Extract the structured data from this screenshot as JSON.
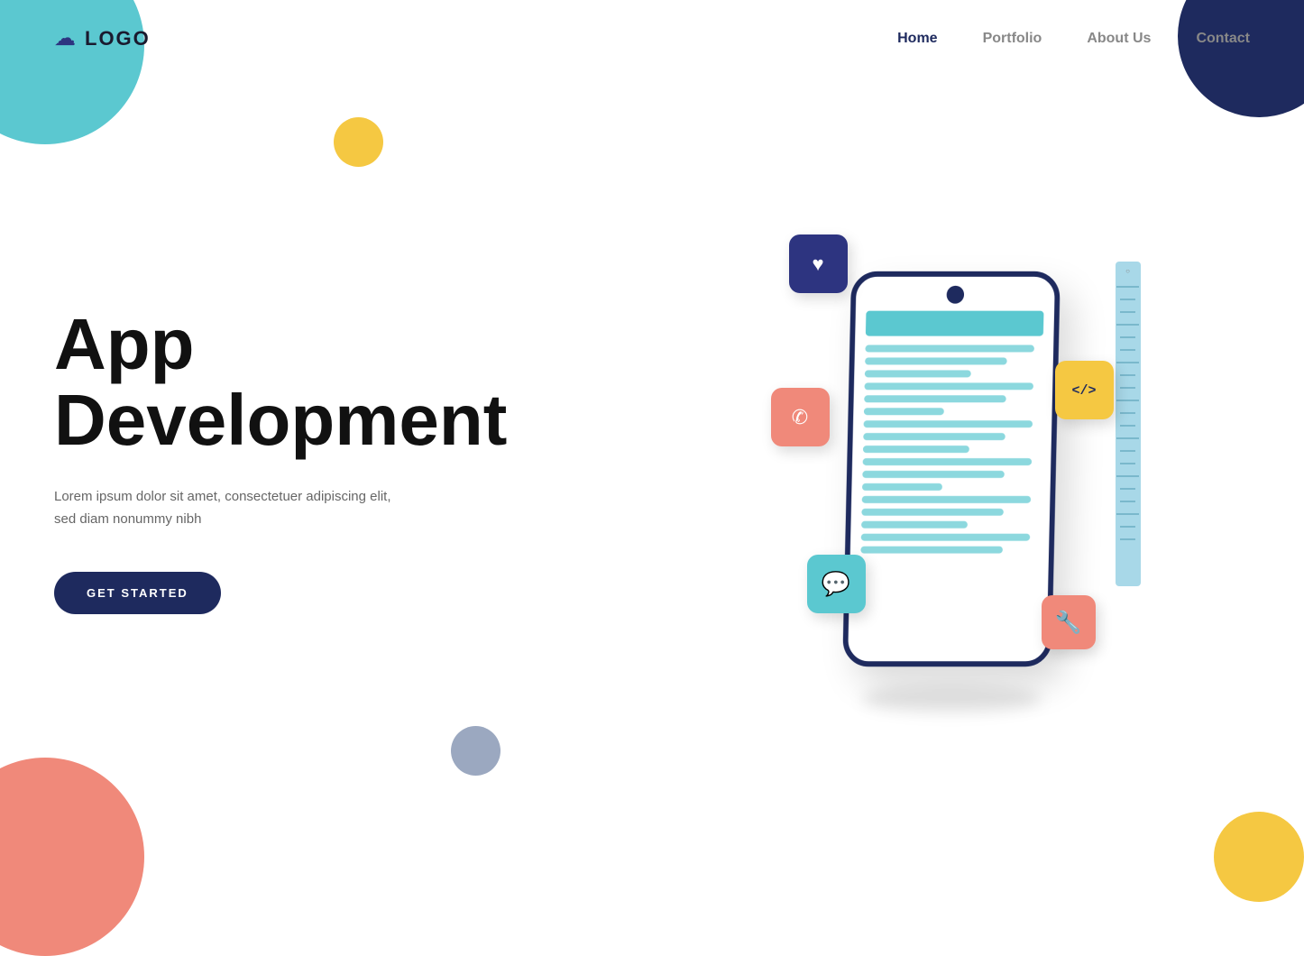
{
  "nav": {
    "logo_icon": "☁",
    "logo_text": "LOGO",
    "links": [
      {
        "label": "Home",
        "active": true
      },
      {
        "label": "Portfolio",
        "active": false
      },
      {
        "label": "About Us",
        "active": false
      },
      {
        "label": "Contact",
        "active": false
      }
    ]
  },
  "hero": {
    "title_line1": "App",
    "title_line2": "Development",
    "subtitle": "Lorem ipsum dolor sit amet, consectetuer adipiscing elit, sed diam nonummy nibh",
    "cta_label": "GET STARTED"
  },
  "decorative": {
    "circle_teal": "#5bc8d0",
    "circle_yellow": "#f5c842",
    "circle_navy": "#1e2a5e",
    "circle_salmon": "#f0897a",
    "circle_gray": "#9ba8c0"
  },
  "phone_icons": {
    "heart": "♥",
    "phone": "✆",
    "chat": "💬",
    "code": "</>",
    "wrench": "🔧"
  }
}
